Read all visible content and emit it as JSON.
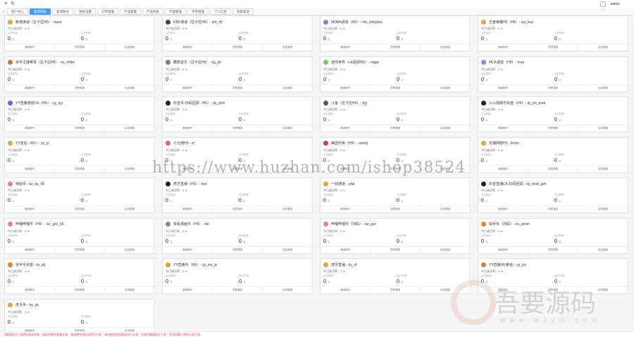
{
  "topbar": {
    "user": "admin"
  },
  "tabs": [
    "商户中心",
    "渠道列表",
    "渠道账号",
    "系统设置",
    "订单管理",
    "产品管理",
    "产品列表",
    "代理管理",
    "手续管理",
    "个人信息",
    "商家渠道"
  ],
  "active_tab": 1,
  "card_labels": {
    "rate": "今日成功率：0 %",
    "left": "今日成功",
    "right": "今日失败",
    "unit": "元",
    "btn1": "通道编号",
    "btn2": "查看通道",
    "btn3": "启用通道"
  },
  "cards": [
    {
      "title": "新增通道（拉卡拉H5）- haoh",
      "color": "#e8a33c",
      "value_left": "0",
      "value_right": "0"
    },
    {
      "title": "DNF通道（拉卡拉H5）- dnf_h5",
      "color": "#444444",
      "value_left": "0",
      "value_right": "0"
    },
    {
      "title": "MOBA通道（H5）- mb_zhifubao",
      "color": "#6c8fd6",
      "value_left": "0",
      "value_right": "0"
    },
    {
      "title": "王者荣耀H5（H5）- wz_hua",
      "color": "#e8a33c",
      "value_left": "0",
      "value_right": "0"
    },
    {
      "title": "快手主播带货（拉卡拉H5）- ks_zhibo",
      "color": "#c9743b",
      "value_left": "0",
      "value_right": "0"
    },
    {
      "title": "酷狗音乐（拉卡拉H5）- kg_yb",
      "color": "#7c7c7c",
      "value_left": "0",
      "value_right": "0"
    },
    {
      "title": "迷你世界（uni回调H5）- wsjjw",
      "color": "#7fbf6a",
      "value_left": "0",
      "value_right": "0"
    },
    {
      "title": "MUA语音（H5）- mua",
      "color": "#a77de0",
      "value_left": "0",
      "value_right": "0"
    },
    {
      "title": "YY直播通道CK（H5）- yy_zjy",
      "color": "#8a4fe0",
      "value_left": "0",
      "value_right": "0"
    },
    {
      "title": "抖音币-扫码回调（H5）- dy_zfsh",
      "color": "#222222",
      "value_left": "0",
      "value_right": "0"
    },
    {
      "title": "斗鱼（拉卡拉H5）- dyj",
      "color": "#555555",
      "value_left": "0",
      "value_right": "0"
    },
    {
      "title": "火山视频币充值（H5）- dy_hs_mob",
      "color": "#222222",
      "value_left": "0",
      "value_right": "0"
    },
    {
      "title": "YY金钻（H5）- yy_jz",
      "color": "#e8a33c",
      "value_left": "0",
      "value_right": "0"
    },
    {
      "title": "六元通H5 - zf",
      "color": "#e86060",
      "value_left": "0",
      "value_right": "0"
    },
    {
      "title": "美团外卖（H5）- wmtsj",
      "color": "#d33d3d",
      "value_left": "0",
      "value_right": "0"
    },
    {
      "title": "龙魂网络H5 - lloom",
      "color": "#e8a33c",
      "value_left": "0",
      "value_right": "0"
    },
    {
      "title": "咪咕币 - bz_bz_h5",
      "color": "#e87a8a",
      "value_left": "0",
      "value_right": "0"
    },
    {
      "title": "虎牙直播（H5）- hys",
      "color": "#222222",
      "value_left": "0",
      "value_right": "0"
    },
    {
      "title": "一刻通道 - ydw",
      "color": "#e8a33c",
      "value_left": "0",
      "value_right": "0"
    },
    {
      "title": "抖音直播CK-扫码回调 - dy_mob_gzh",
      "color": "#222222",
      "value_left": "0",
      "value_right": "0"
    },
    {
      "title": "哔哩哔哩币（H5）- bz_gzz_h5",
      "color": "#e87aa0",
      "value_left": "0",
      "value_right": "0"
    },
    {
      "title": "快看漫画币（H5）- kkl",
      "color": "#8a8a8a",
      "value_left": "0",
      "value_right": "0"
    },
    {
      "title": "哔哩哔哩币（扫码）- bz_gzz",
      "color": "#e87aa0",
      "value_left": "0",
      "value_right": "0"
    },
    {
      "title": "快手币（扫码）- ks_zbsm",
      "color": "#e8852c",
      "value_left": "0",
      "value_right": "0"
    },
    {
      "title": "快手币充值 - ks_kb",
      "color": "#e8852c",
      "value_left": "0",
      "value_right": "0"
    },
    {
      "title": "YY直播币（H5）- yy_zsr_jk",
      "color": "#d8a13c",
      "value_left": "0",
      "value_right": "0"
    },
    {
      "title": "虎牙直播 - hy_zf",
      "color": "#e8a33c",
      "value_left": "0",
      "value_right": "0"
    },
    {
      "title": "YY直播币(通道) - yy_jsc",
      "color": "#b88a2c",
      "value_left": "0",
      "value_right": "0"
    },
    {
      "title": "虎牙币 - hy_zb",
      "color": "#e8a33c",
      "value_left": "0",
      "value_right": "0"
    }
  ],
  "notice": "【重要提示】如遇到通道异常，请及时联系客服处理；通道费率按实际签约为准；请勿使用违规渠道进行交易；如有问题请提交工单；资金结算以系统记录为准。",
  "watermark": {
    "url": "https://www.huzhan.com/ishop38524",
    "site_cn": "吾要源码",
    "site_en": "www.w1ym.com"
  }
}
